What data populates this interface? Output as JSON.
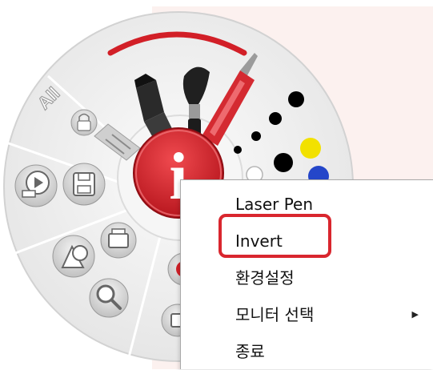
{
  "radial_menu": {
    "tools": [
      "highlighter",
      "paintbrush",
      "pen",
      "eraser"
    ],
    "palette": {
      "colors": [
        "#000000",
        "#000000",
        "#000000",
        "#000000",
        "#000000",
        "#f2e100",
        "#ffffff",
        "#2446c9"
      ],
      "accent": "#d9262e"
    },
    "center_logo_text": "i",
    "left_labels": {
      "all": "All"
    }
  },
  "context_menu": {
    "items": [
      {
        "label": "Laser Pen"
      },
      {
        "label": "Invert",
        "highlighted": true
      },
      {
        "label": "환경설정"
      },
      {
        "label": "모니터 선택",
        "has_submenu": true,
        "arrow": "▶"
      },
      {
        "label": "종료"
      }
    ]
  },
  "colors": {
    "panel_bg": "#fcf1ef",
    "highlight_border": "#d9262e"
  }
}
